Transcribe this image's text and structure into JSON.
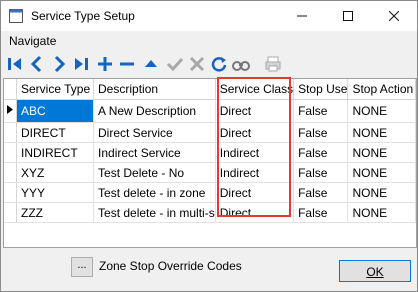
{
  "window": {
    "title": "Service Type Setup"
  },
  "menu": {
    "navigate": "Navigate"
  },
  "toolbar": {
    "items": [
      "first-record",
      "previous-record",
      "next-record",
      "last-record",
      "add-record",
      "delete-record",
      "move-up",
      "post-edit",
      "cancel-edit",
      "refresh",
      "find",
      "print"
    ]
  },
  "grid": {
    "columns": [
      "Service Type",
      "Description",
      "Service Class",
      "Stop Use",
      "Stop Action"
    ],
    "rows": [
      [
        "ABC",
        "A New Description",
        "Direct",
        "False",
        "NONE"
      ],
      [
        "DIRECT",
        "Direct Service",
        "Direct",
        "False",
        "NONE"
      ],
      [
        "INDIRECT",
        "Indirect Service",
        "Indirect",
        "False",
        "NONE"
      ],
      [
        "XYZ",
        "Test Delete - No",
        "Indirect",
        "False",
        "NONE"
      ],
      [
        "YYY",
        "Test delete - in zone",
        "Direct",
        "False",
        "NONE"
      ],
      [
        "ZZZ",
        "Test delete - in multi-s",
        "Direct",
        "False",
        "NONE"
      ]
    ]
  },
  "footer": {
    "ellipsis": "...",
    "zone_label": "Zone Stop Override Codes",
    "ok": "OK"
  },
  "colors": {
    "toolbar_blue": "#1565c0",
    "highlight_red": "#e03c31",
    "selection": "#0078d7"
  }
}
